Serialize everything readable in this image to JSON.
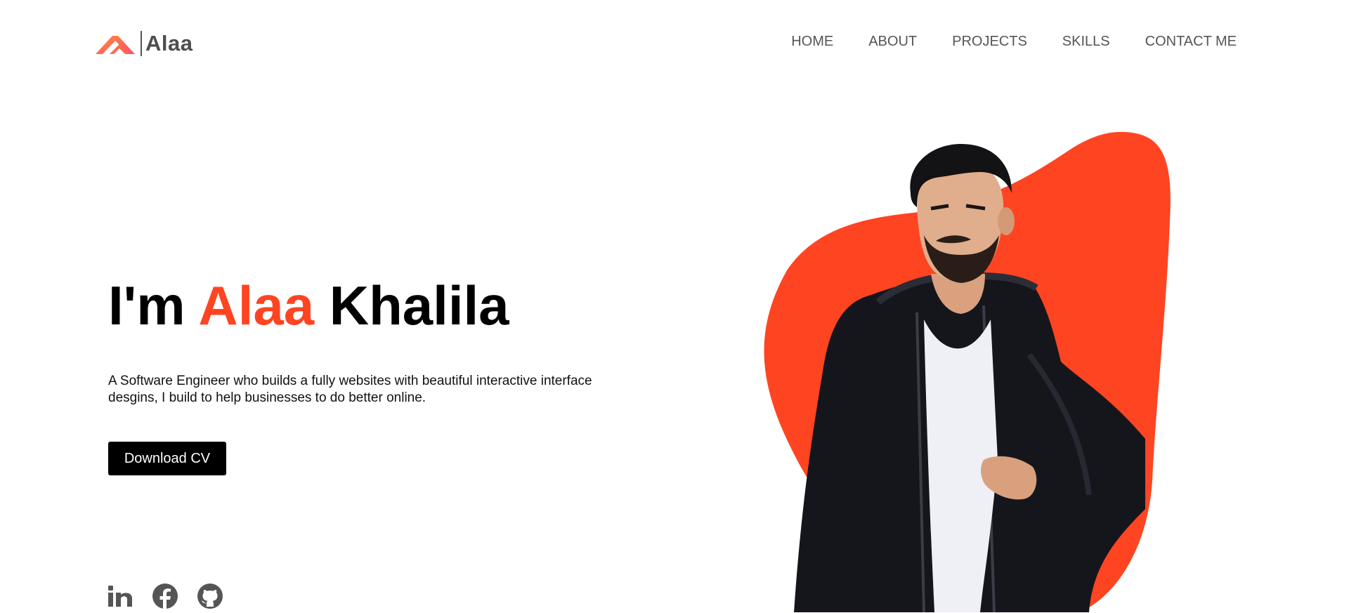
{
  "header": {
    "logo_text": "Alaa",
    "nav": [
      "HOME",
      "ABOUT",
      "PROJECTS",
      "SKILLS",
      "CONTACT ME"
    ]
  },
  "hero": {
    "title_prefix": "I'm ",
    "title_highlight": "Alaa",
    "title_suffix": " Khalila",
    "description": "A Software Engineer who builds a fully websites with beautiful interactive interface desgins, I build to help businesses to do better online.",
    "cta_label": "Download CV"
  },
  "socials": {
    "icons": [
      "linkedin-icon",
      "facebook-icon",
      "github-icon"
    ]
  },
  "colors": {
    "accent": "#ff4422",
    "logo_gradient": [
      "#ff7a3a",
      "#ff4f6d"
    ],
    "text_dark": "#000000",
    "nav_text": "#555555",
    "icon_gray": "#555555"
  }
}
